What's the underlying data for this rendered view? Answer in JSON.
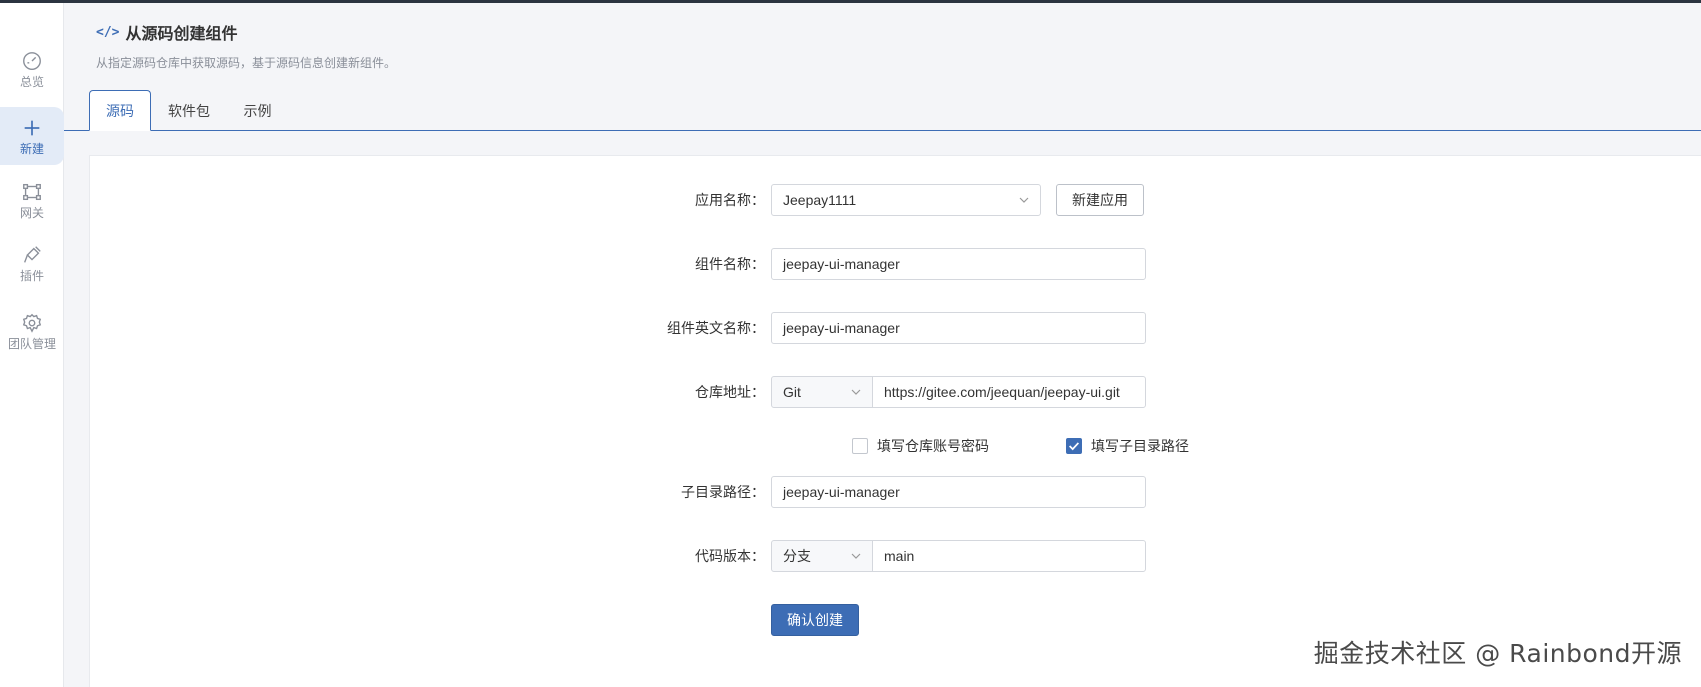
{
  "sidebar": {
    "items": [
      {
        "label": "总览",
        "icon": "dashboard-icon"
      },
      {
        "label": "新建",
        "icon": "plus-icon",
        "active": true
      },
      {
        "label": "网关",
        "icon": "gateway-icon"
      },
      {
        "label": "插件",
        "icon": "plugin-icon"
      },
      {
        "label": "团队管理",
        "icon": "gear-icon"
      }
    ]
  },
  "header": {
    "icon": "code-icon",
    "icon_text": "</>",
    "title": "从源码创建组件",
    "subtitle": "从指定源码仓库中获取源码，基于源码信息创建新组件。"
  },
  "tabs": [
    {
      "label": "源码",
      "active": true
    },
    {
      "label": "软件包"
    },
    {
      "label": "示例"
    }
  ],
  "form": {
    "app_name": {
      "label": "应用名称",
      "value": "Jeepay1111"
    },
    "new_app_button": "新建应用",
    "component_name": {
      "label": "组件名称",
      "value": "jeepay-ui-manager"
    },
    "component_en_name": {
      "label": "组件英文名称",
      "value": "jeepay-ui-manager"
    },
    "repo": {
      "label": "仓库地址",
      "type": "Git",
      "url": "https://gitee.com/jeequan/jeepay-ui.git"
    },
    "checkbox_account": {
      "label": "填写仓库账号密码",
      "checked": false
    },
    "checkbox_subdir": {
      "label": "填写子目录路径",
      "checked": true
    },
    "subdir": {
      "label": "子目录路径",
      "value": "jeepay-ui-manager"
    },
    "code_version": {
      "label": "代码版本",
      "type": "分支",
      "value": "main"
    },
    "submit_button": "确认创建"
  },
  "watermark": "掘金技术社区 @ Rainbond开源",
  "colors": {
    "accent": "#3d6db5",
    "background": "#f4f5f8"
  }
}
